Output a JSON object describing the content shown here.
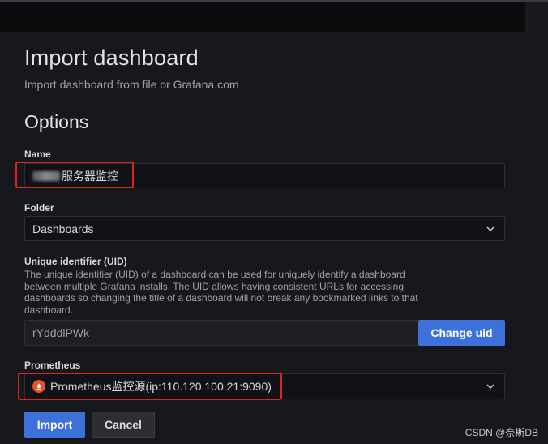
{
  "page": {
    "title": "Import dashboard",
    "subtitle": "Import dashboard from file or Grafana.com",
    "section_title": "Options"
  },
  "name_field": {
    "label": "Name",
    "value": "服务器监控"
  },
  "folder_field": {
    "label": "Folder",
    "value": "Dashboards"
  },
  "uid_field": {
    "label": "Unique identifier (UID)",
    "description": "The unique identifier (UID) of a dashboard can be used for uniquely identify a dashboard between multiple Grafana installs. The UID allows having consistent URLs for accessing dashboards so changing the title of a dashboard will not break any bookmarked links to that dashboard.",
    "value": "rYdddlPWk",
    "change_button": "Change uid"
  },
  "prometheus_field": {
    "label": "Prometheus",
    "value": "Prometheus监控源(ip:110.120.100.21:9090)",
    "icon": "prometheus-icon"
  },
  "actions": {
    "import": "Import",
    "cancel": "Cancel"
  },
  "watermark": "CSDN @奈斯DB",
  "colors": {
    "accent": "#3d71d9",
    "highlight": "#e0231b",
    "prometheus": "#e6522c"
  }
}
